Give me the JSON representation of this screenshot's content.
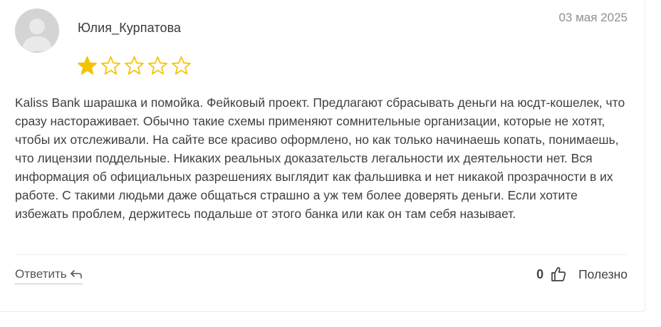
{
  "review": {
    "author": "Юлия_Курпатова",
    "date": "03 мая 2025",
    "rating": 1,
    "rating_max": 5,
    "text": "Kaliss Bank шарашка и помойка. Фейковый проект. Предлагают сбрасывать деньги на юсдт-кошелек, что сразу настораживает. Обычно такие схемы применяют сомнительные организации, которые не хотят, чтобы их отслеживали. На сайте все красиво оформлено, но как только начинаешь копать, понимаешь, что лицензии поддельные. Никаких реальных доказательств легальности их деятельности нет. Вся информация об официальных разрешениях выглядит как фальшивка и нет никакой прозрачности в их работе. С такими людьми даже общаться страшно а уж тем более доверять деньги. Если хотите избежать проблем, держитесь подальше от этого банка или как он там себя называет.",
    "avatar_icon": "user-avatar-placeholder"
  },
  "actions": {
    "reply_label": "Ответить",
    "reply_icon": "reply-arrow-icon",
    "like_count": "0",
    "like_icon": "thumbs-up-icon",
    "helpful_label": "Полезно"
  },
  "colors": {
    "star_filled": "#f2c300",
    "star_outline": "#f2c300",
    "text": "#3f3f3f",
    "muted": "#8f8f8f",
    "avatar_bg": "#d4d4d4"
  }
}
